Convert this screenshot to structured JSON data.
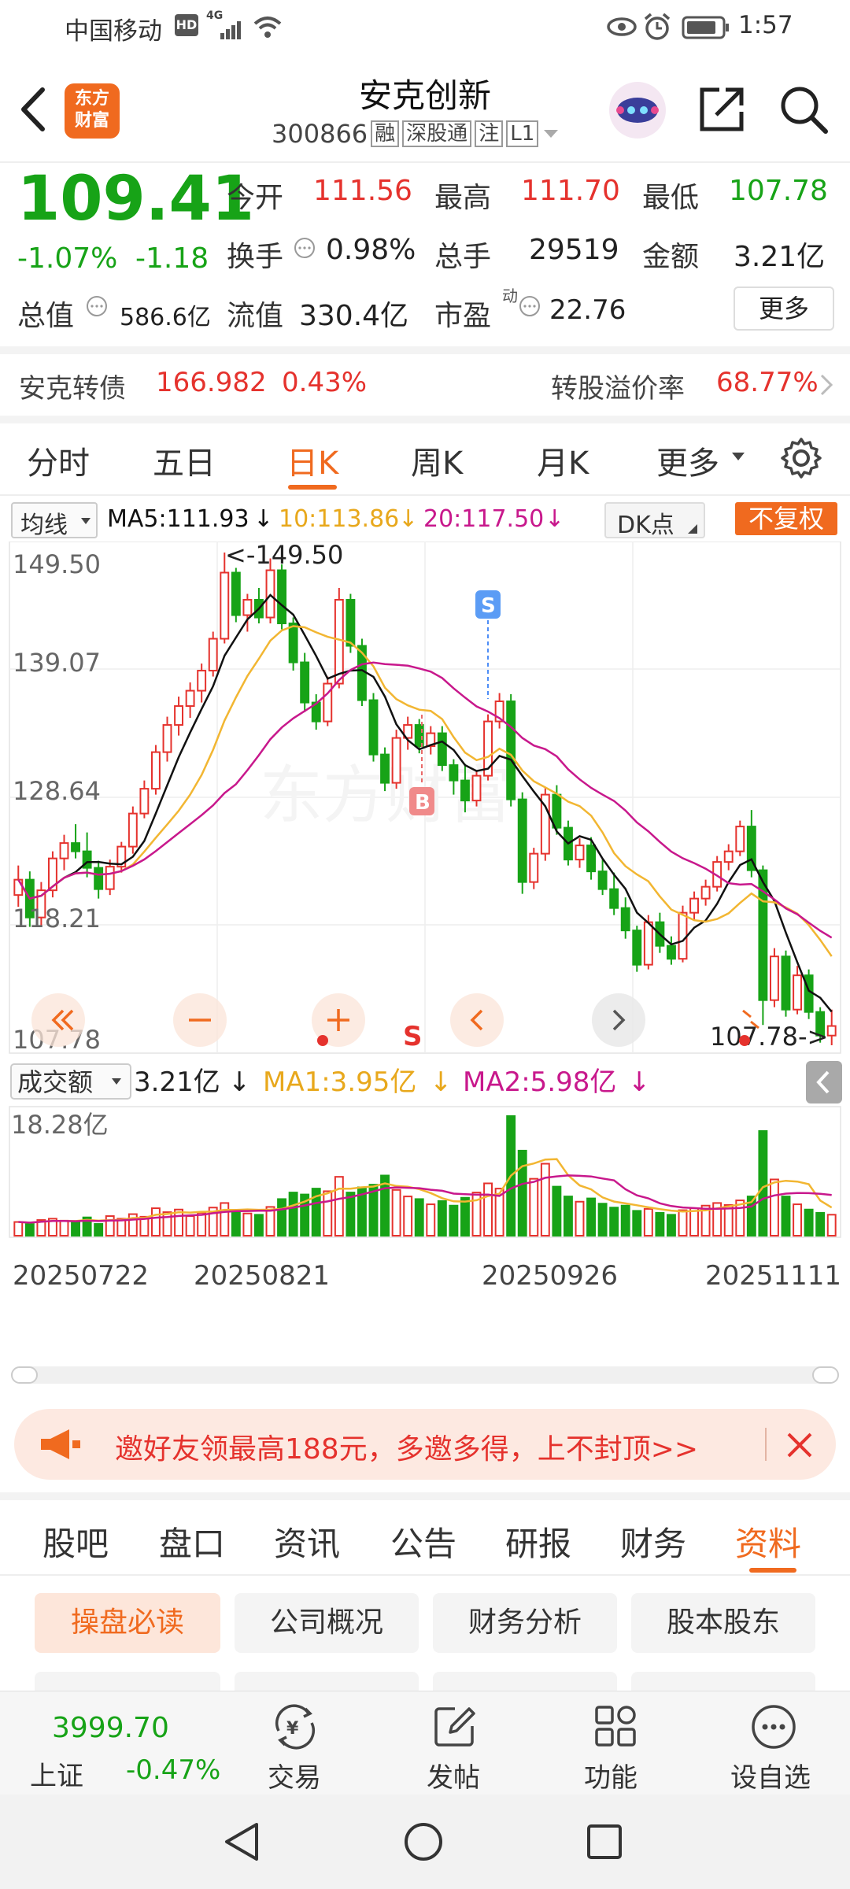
{
  "status_bar": {
    "carrier": "中国移动",
    "network": "4G",
    "time": "1:57"
  },
  "header": {
    "logo_text": "东方\n财富",
    "stock_name": "安克创新",
    "stock_code": "300866",
    "tags": [
      "融",
      "深股通",
      "注",
      "L1"
    ]
  },
  "quote": {
    "price": "109.41",
    "change_pct": "-1.07%",
    "change": "-1.18",
    "open_label": "今开",
    "open": "111.56",
    "high_label": "最高",
    "high": "111.70",
    "low_label": "最低",
    "low": "107.78",
    "turnover_label": "换手",
    "turnover": "0.98%",
    "volume_label": "总手",
    "volume": "29519",
    "amount_label": "金额",
    "amount": "3.21亿",
    "mcap_label": "总值",
    "mcap": "586.6亿",
    "float_label": "流值",
    "float_cap": "330.4亿",
    "pe_label": "市盈",
    "pe_sup": "动",
    "pe": "22.76",
    "more_label": "更多"
  },
  "bond": {
    "name": "安克转债",
    "price": "166.982",
    "pct": "0.43%",
    "premium_label": "转股溢价率",
    "premium": "68.77%"
  },
  "period_tabs": {
    "items": [
      "分时",
      "五日",
      "日K",
      "周K",
      "月K",
      "更多"
    ],
    "active": "日K"
  },
  "ma_bar": {
    "selector": "均线",
    "ma5": "MA5:111.93",
    "ma10": "10:113.86",
    "ma20": "20:117.50",
    "dk": "DK点",
    "fq": "不复权"
  },
  "kline": {
    "y_labels": [
      "149.50",
      "139.07",
      "128.64",
      "118.21",
      "107.78"
    ],
    "high_marker": "<-149.50",
    "low_marker": "107.78->",
    "s_marker": "S",
    "b_marker": "B",
    "watermark": "东方财富",
    "controls_s": "S"
  },
  "volume_bar": {
    "selector": "成交额",
    "value": "3.21亿",
    "ma1": "MA1:3.95亿",
    "ma2": "MA2:5.98亿",
    "max_label": "18.28亿"
  },
  "dates": [
    "20250722",
    "20250821",
    "20250926",
    "20251111"
  ],
  "promo": {
    "text": "邀好友领最高188元，多邀多得，上不封顶>>"
  },
  "content_tabs": {
    "items": [
      "股吧",
      "盘口",
      "资讯",
      "公告",
      "研报",
      "财务",
      "资料"
    ],
    "active": "资料"
  },
  "sub_tabs": {
    "items": [
      "操盘必读",
      "公司概况",
      "财务分析",
      "股本股东"
    ],
    "active": "操盘必读"
  },
  "bottom_nav": {
    "index_value": "3999.70",
    "index_name": "上证",
    "index_pct": "-0.47%",
    "items": [
      "交易",
      "发帖",
      "功能",
      "设自选"
    ]
  },
  "colors": {
    "up": "#e5322d",
    "down": "#17a317",
    "accent": "#f06a1f",
    "ma5": "#111111",
    "ma10": "#f2b632",
    "ma20": "#c8188c"
  },
  "chart_data": {
    "type": "candlestick",
    "ylim": [
      107.78,
      149.5
    ],
    "candles": [
      [
        120.5,
        123.0,
        119.5,
        121.8
      ],
      [
        121.8,
        122.5,
        117.8,
        118.6
      ],
      [
        118.6,
        121.6,
        117.9,
        120.9
      ],
      [
        120.9,
        124.2,
        120.3,
        123.6
      ],
      [
        123.6,
        125.6,
        122.6,
        124.9
      ],
      [
        124.9,
        126.5,
        123.6,
        124.2
      ],
      [
        124.2,
        125.8,
        122.0,
        122.8
      ],
      [
        122.8,
        123.4,
        120.2,
        121.0
      ],
      [
        121.0,
        123.5,
        120.5,
        122.9
      ],
      [
        122.9,
        125.0,
        122.4,
        124.6
      ],
      [
        124.6,
        128.0,
        124.0,
        127.4
      ],
      [
        127.4,
        130.2,
        127.0,
        129.5
      ],
      [
        129.5,
        133.2,
        129.0,
        132.6
      ],
      [
        132.6,
        135.6,
        131.8,
        134.9
      ],
      [
        134.9,
        137.3,
        134.0,
        136.5
      ],
      [
        136.5,
        138.5,
        135.5,
        137.8
      ],
      [
        137.8,
        140.1,
        136.8,
        139.5
      ],
      [
        139.5,
        142.8,
        139.0,
        142.2
      ],
      [
        142.2,
        149.5,
        141.8,
        147.8
      ],
      [
        147.8,
        148.2,
        143.6,
        144.2
      ],
      [
        144.2,
        146.0,
        142.8,
        145.5
      ],
      [
        145.5,
        146.5,
        143.5,
        144.0
      ],
      [
        144.0,
        149.0,
        143.5,
        148.0
      ],
      [
        148.0,
        148.5,
        143.0,
        143.5
      ],
      [
        143.5,
        144.0,
        139.5,
        140.2
      ],
      [
        140.2,
        141.0,
        136.0,
        136.8
      ],
      [
        136.8,
        137.5,
        134.5,
        135.2
      ],
      [
        135.2,
        139.0,
        134.8,
        138.4
      ],
      [
        138.4,
        146.5,
        138.0,
        145.5
      ],
      [
        145.5,
        146.0,
        141.0,
        141.6
      ],
      [
        141.6,
        142.2,
        136.5,
        137.0
      ],
      [
        137.0,
        137.6,
        131.8,
        132.4
      ],
      [
        132.4,
        133.0,
        129.3,
        130.0
      ],
      [
        130.0,
        134.5,
        129.5,
        133.8
      ],
      [
        133.8,
        135.6,
        132.8,
        134.9
      ],
      [
        134.9,
        135.4,
        132.5,
        133.1
      ],
      [
        133.1,
        134.8,
        132.4,
        134.2
      ],
      [
        134.2,
        134.8,
        131.0,
        131.5
      ],
      [
        131.5,
        132.0,
        129.0,
        130.2
      ],
      [
        130.2,
        131.6,
        127.5,
        128.5
      ],
      [
        128.5,
        131.0,
        128.0,
        130.6
      ],
      [
        130.6,
        135.8,
        130.2,
        135.2
      ],
      [
        135.2,
        137.6,
        134.6,
        136.9
      ],
      [
        136.9,
        137.5,
        128.0,
        128.6
      ],
      [
        128.6,
        129.2,
        120.6,
        121.6
      ],
      [
        121.6,
        124.5,
        121.0,
        124.0
      ],
      [
        124.0,
        129.6,
        123.4,
        129.0
      ],
      [
        129.0,
        129.8,
        125.6,
        126.2
      ],
      [
        126.2,
        126.8,
        123.0,
        123.5
      ],
      [
        123.5,
        125.3,
        122.8,
        124.7
      ],
      [
        124.7,
        125.4,
        121.8,
        122.5
      ],
      [
        122.5,
        123.5,
        120.5,
        121.0
      ],
      [
        121.0,
        122.4,
        118.8,
        119.4
      ],
      [
        119.4,
        120.3,
        116.8,
        117.5
      ],
      [
        117.5,
        117.9,
        114.0,
        114.6
      ],
      [
        114.6,
        118.8,
        114.2,
        118.2
      ],
      [
        118.2,
        119.0,
        115.6,
        116.2
      ],
      [
        116.2,
        117.0,
        114.6,
        115.1
      ],
      [
        115.1,
        119.6,
        114.8,
        119.0
      ],
      [
        119.0,
        120.8,
        118.4,
        120.2
      ],
      [
        120.2,
        121.8,
        119.6,
        121.2
      ],
      [
        121.2,
        123.8,
        120.8,
        123.3
      ],
      [
        123.3,
        124.8,
        122.6,
        124.2
      ],
      [
        124.2,
        126.8,
        123.8,
        126.3
      ],
      [
        126.3,
        127.7,
        122.0,
        122.6
      ],
      [
        122.6,
        123.0,
        109.5,
        111.6
      ],
      [
        111.6,
        116.0,
        111.0,
        115.3
      ],
      [
        115.3,
        115.8,
        110.2,
        110.8
      ],
      [
        110.8,
        114.5,
        110.4,
        113.7
      ],
      [
        113.7,
        114.2,
        110.0,
        110.6
      ],
      [
        110.6,
        111.0,
        108.0,
        108.6
      ],
      [
        108.6,
        110.8,
        107.78,
        109.41
      ]
    ],
    "volume": [
      2.1,
      1.9,
      2.4,
      2.6,
      2.3,
      2.0,
      2.8,
      1.8,
      3.0,
      2.6,
      3.3,
      2.9,
      4.2,
      3.6,
      4.0,
      3.0,
      3.5,
      4.3,
      5.0,
      3.9,
      3.4,
      3.2,
      4.4,
      5.6,
      6.6,
      6.3,
      7.2,
      6.8,
      9.0,
      6.6,
      7.4,
      7.8,
      9.2,
      7.0,
      6.0,
      5.6,
      4.8,
      5.3,
      4.6,
      5.8,
      6.6,
      8.0,
      7.2,
      18.28,
      13.0,
      8.7,
      11.0,
      7.5,
      6.0,
      5.2,
      5.7,
      4.9,
      4.3,
      4.6,
      3.8,
      4.1,
      3.5,
      3.2,
      3.9,
      4.2,
      4.6,
      5.0,
      4.7,
      5.4,
      6.0,
      16.0,
      8.6,
      6.0,
      4.8,
      4.0,
      3.5,
      3.21
    ],
    "volume_ylim": [
      0,
      18.28
    ],
    "x_ticks": [
      "20250722",
      "20250821",
      "20250926",
      "20251111"
    ]
  }
}
